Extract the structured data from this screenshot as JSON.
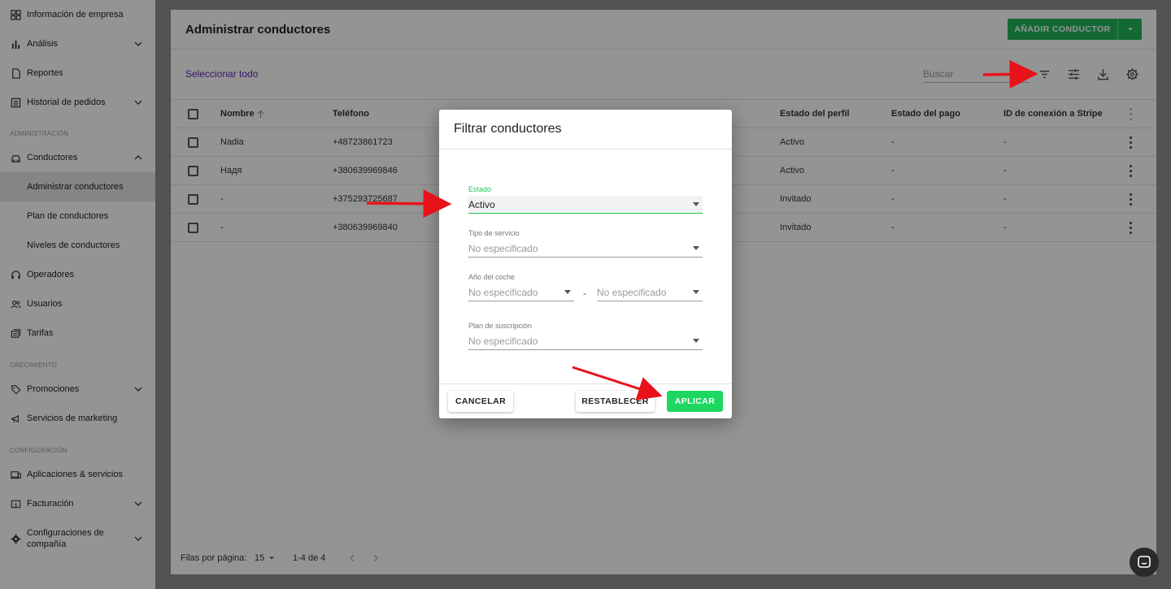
{
  "sidebar": {
    "items": [
      {
        "label": "Información de empresa"
      },
      {
        "label": "Análisis"
      },
      {
        "label": "Reportes"
      },
      {
        "label": "Historial de pedidos"
      },
      {
        "label": "Conductores"
      },
      {
        "label": "Administrar conductores"
      },
      {
        "label": "Plan de conductores"
      },
      {
        "label": "Niveles de conductores"
      },
      {
        "label": "Operadores"
      },
      {
        "label": "Usuarios"
      },
      {
        "label": "Tarifas"
      },
      {
        "label": "Promociones"
      },
      {
        "label": "Servicios de marketing"
      },
      {
        "label": "Aplicaciones & servicios"
      },
      {
        "label": "Facturación"
      },
      {
        "label": "Configuraciones de compañía"
      }
    ],
    "sections": {
      "admin": "ADMINISTRACIÓN",
      "growth": "CRECIMIENTO",
      "config": "CONFIGURACIÓN"
    }
  },
  "header": {
    "title": "Administrar conductores",
    "add_button": "AÑADIR CONDUCTOR"
  },
  "toolbar": {
    "select_all": "Seleccionar todo",
    "search_placeholder": "Buscar"
  },
  "table": {
    "columns": [
      "Nombre",
      "Teléfono",
      "Estado del perfil",
      "Estado del pago",
      "ID de conexión a Stripe"
    ],
    "rows": [
      {
        "name": "Nadia",
        "phone": "+48723861723",
        "profile": "Activo",
        "payment": "-",
        "stripe": "-"
      },
      {
        "name": "Надя",
        "phone": "+380639969846",
        "profile": "Activo",
        "payment": "-",
        "stripe": "-"
      },
      {
        "name": "-",
        "phone": "+375293725687",
        "profile": "Invitado",
        "payment": "-",
        "stripe": "-"
      },
      {
        "name": "-",
        "phone": "+380639969840",
        "profile": "Invitado",
        "payment": "-",
        "stripe": "-"
      }
    ]
  },
  "pagination": {
    "rows_per_page_label": "Filas por página:",
    "rows_per_page": "15",
    "range": "1-4 de 4"
  },
  "dialog": {
    "title": "Filtrar conductores",
    "fields": {
      "status_label": "Estado",
      "status_value": "Activo",
      "service_label": "Tipo de servicio",
      "service_value": "No especificado",
      "year_label": "Año del coche",
      "year_from": "No especificado",
      "year_sep": "-",
      "year_to": "No especificado",
      "plan_label": "Plan de suscripción",
      "plan_value": "No especificado"
    },
    "buttons": {
      "cancel": "CANCELAR",
      "reset": "RESTABLECER",
      "apply": "APLICAR"
    }
  },
  "colors": {
    "brand_green": "#1fb55a",
    "apply_green": "#1ed760",
    "link_purple": "#5b2bb0",
    "annotation_red": "#e8121a"
  }
}
